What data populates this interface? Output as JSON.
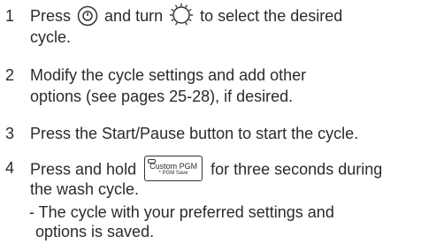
{
  "steps": [
    {
      "number": "1",
      "lines": [
        "Press",
        "and turn",
        "to select the desired",
        "cycle."
      ],
      "icons": [
        "power-button-icon",
        "cycle-dial-icon"
      ]
    },
    {
      "number": "2",
      "lines": [
        "Modify the cycle settings and add other",
        "options (see pages 25-28), if desired."
      ]
    },
    {
      "number": "3",
      "lines": [
        "Press the Start/Pause button to start the cycle."
      ]
    },
    {
      "number": "4",
      "lines": [
        "Press and hold",
        "for three seconds during",
        "the wash cycle."
      ],
      "button": {
        "label": "Custom PGM",
        "sublabel": "* PGM Save"
      }
    }
  ],
  "result_note": [
    "- The cycle with your preferred settings and",
    "options is saved."
  ]
}
